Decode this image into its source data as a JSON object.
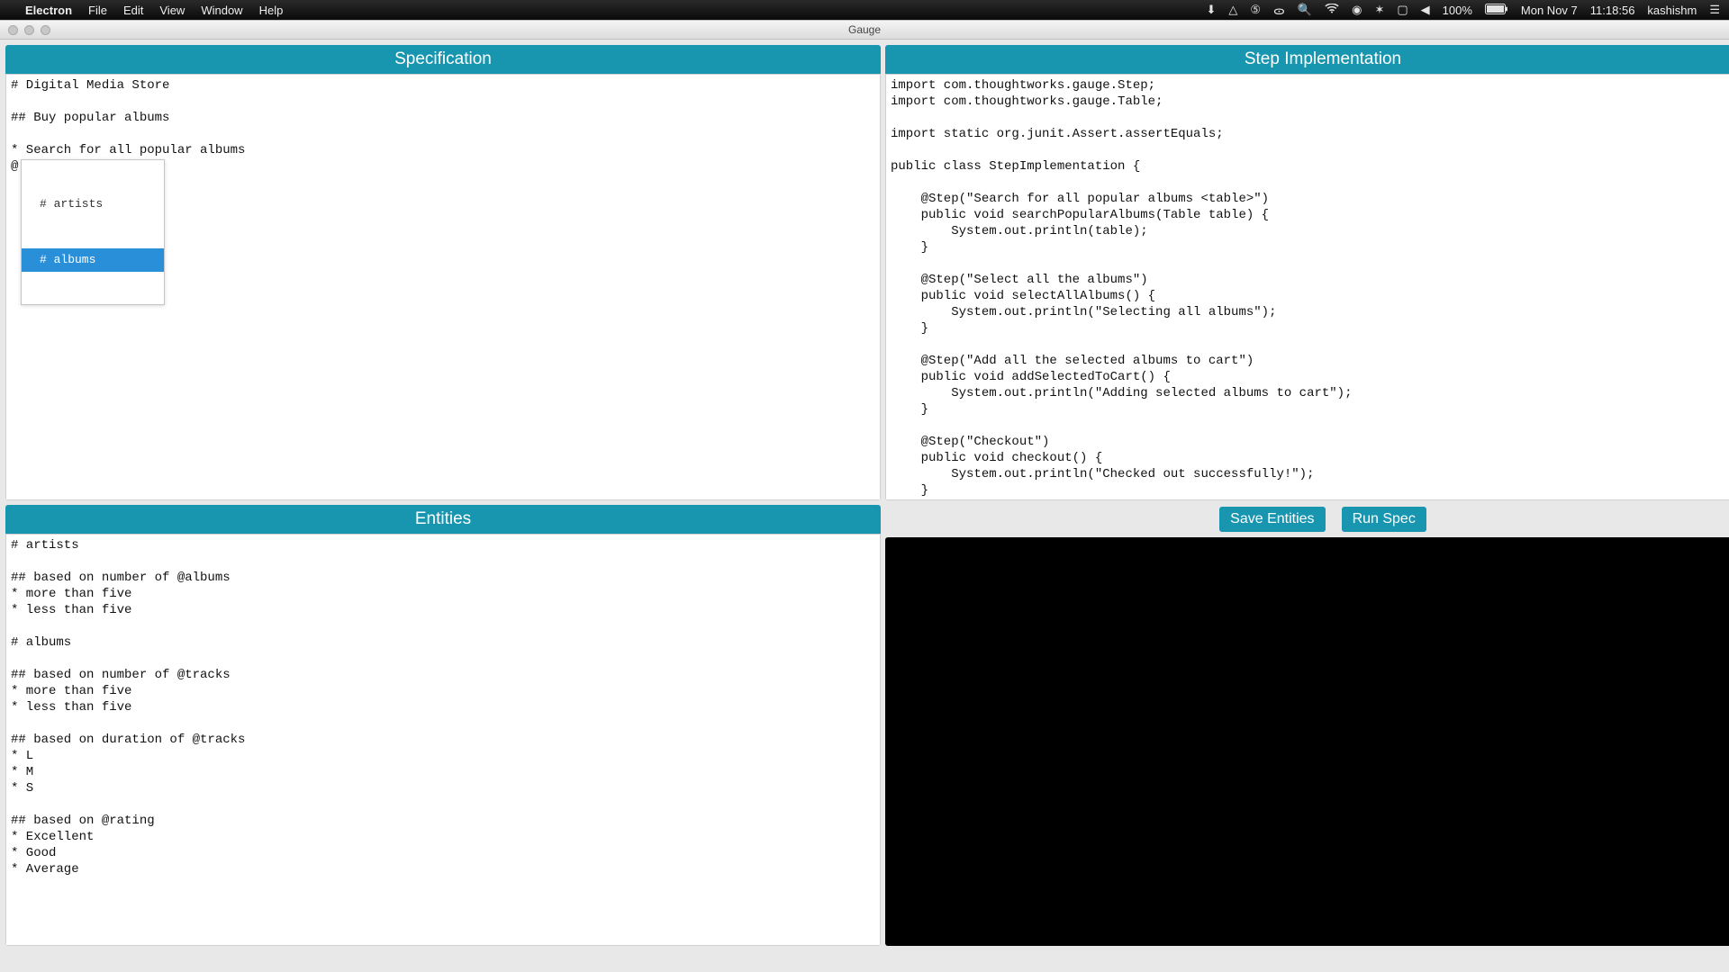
{
  "menubar": {
    "app": "Electron",
    "items": [
      "File",
      "Edit",
      "View",
      "Window",
      "Help"
    ],
    "battery": "100%",
    "date": "Mon Nov 7",
    "time": "11:18:56",
    "user": "kashishm"
  },
  "titlebar": {
    "title": "Gauge"
  },
  "panels": {
    "spec_header": "Specification",
    "impl_header": "Step Implementation",
    "entities_header": "Entities"
  },
  "spec_text": "# Digital Media Store\n\n## Buy popular albums\n\n* Search for all popular albums\n@",
  "autocomplete": {
    "items": [
      "# artists",
      "# albums"
    ],
    "selected_index": 1
  },
  "impl_text": "import com.thoughtworks.gauge.Step;\nimport com.thoughtworks.gauge.Table;\n\nimport static org.junit.Assert.assertEquals;\n\npublic class StepImplementation {\n\n    @Step(\"Search for all popular albums <table>\")\n    public void searchPopularAlbums(Table table) {\n        System.out.println(table);\n    }\n\n    @Step(\"Select all the albums\")\n    public void selectAllAlbums() {\n        System.out.println(\"Selecting all albums\");\n    }\n\n    @Step(\"Add all the selected albums to cart\")\n    public void addSelectedToCart() {\n        System.out.println(\"Adding selected albums to cart\");\n    }\n\n    @Step(\"Checkout\")\n    public void checkout() {\n        System.out.println(\"Checked out successfully!\");\n    }",
  "entities_text": "# artists\n\n## based on number of @albums\n* more than five\n* less than five\n\n# albums\n\n## based on number of @tracks\n* more than five\n* less than five\n\n## based on duration of @tracks\n* L\n* M\n* S\n\n## based on @rating\n* Excellent\n* Good\n* Average",
  "buttons": {
    "save": "Save Entities",
    "run": "Run Spec"
  }
}
